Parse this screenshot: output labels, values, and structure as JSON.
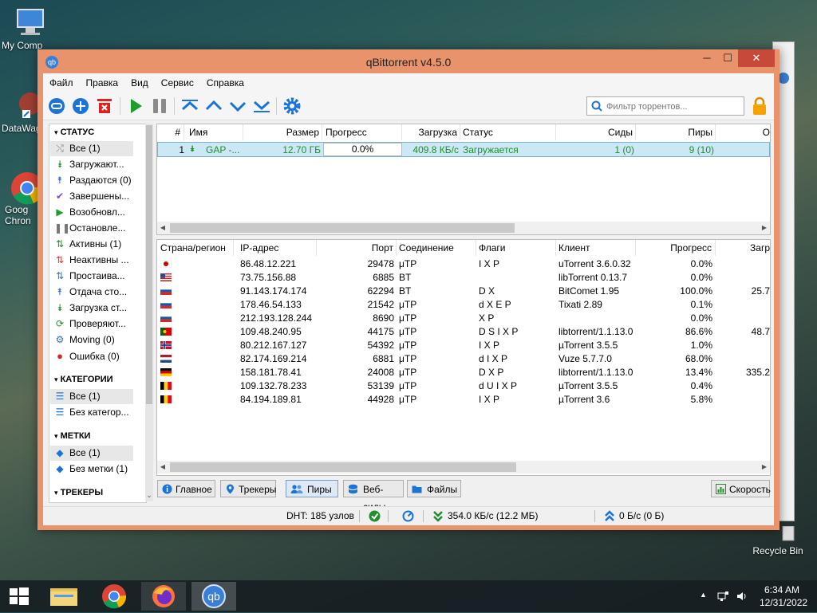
{
  "desktop": {
    "icons": [
      {
        "label": "My Comp"
      },
      {
        "label": "DataWag"
      },
      {
        "label": "Goog Chron"
      },
      {
        "label": "Recycle Bin"
      }
    ]
  },
  "window": {
    "title": "qBittorrent v4.5.0",
    "controls": {
      "minimize": "─",
      "maximize": "☐",
      "close": "✕"
    }
  },
  "menu": [
    "Файл",
    "Правка",
    "Вид",
    "Сервис",
    "Справка"
  ],
  "search": {
    "placeholder": "Фильтр торрентов..."
  },
  "sidebar": {
    "status_header": "СТАТУС",
    "status_items": [
      {
        "icon": "all",
        "label": "Все (1)",
        "color": "#888"
      },
      {
        "icon": "downloading",
        "label": "Загружают...",
        "color": "#1e8f2b"
      },
      {
        "icon": "seeding",
        "label": "Раздаются (0)",
        "color": "#3a6fc4"
      },
      {
        "icon": "completed",
        "label": "Завершены...",
        "color": "#7b4bc4"
      },
      {
        "icon": "resumed",
        "label": "Возобновл...",
        "color": "#1e9f2b"
      },
      {
        "icon": "paused",
        "label": "Остановле...",
        "color": "#777"
      },
      {
        "icon": "active",
        "label": "Активны (1)",
        "color": "#1e8f2b"
      },
      {
        "icon": "inactive",
        "label": "Неактивны ...",
        "color": "#d33"
      },
      {
        "icon": "stalled",
        "label": "Простаива...",
        "color": "#3a6fc4"
      },
      {
        "icon": "stalled-upload",
        "label": "Отдача сто...",
        "color": "#3a6fc4"
      },
      {
        "icon": "stalled-download",
        "label": "Загрузка ст...",
        "color": "#1e8f2b"
      },
      {
        "icon": "checking",
        "label": "Проверяют...",
        "color": "#1e8f2b"
      },
      {
        "icon": "moving",
        "label": "Moving (0)",
        "color": "#3a6fc4"
      },
      {
        "icon": "error",
        "label": "Ошибка (0)",
        "color": "#d22"
      }
    ],
    "categories_header": "КАТЕГОРИИ",
    "category_items": [
      {
        "label": "Все (1)"
      },
      {
        "label": "Без категор..."
      }
    ],
    "tags_header": "МЕТКИ",
    "tag_items": [
      {
        "label": "Все (1)"
      },
      {
        "label": "Без метки (1)"
      }
    ],
    "trackers_header": "ТРЕКЕРЫ"
  },
  "torrent_table": {
    "headers": [
      "#",
      "Имя",
      "Размер",
      "Прогресс",
      "Загрузка",
      "Статус",
      "Сиды",
      "Пиры",
      "О"
    ],
    "rows": [
      {
        "num": "1",
        "name": "GAP -...",
        "size": "12.70 ГБ",
        "progress": "0.0%",
        "dl_speed": "409.8 КБ/с",
        "status": "Загружается",
        "seeds": "1 (0)",
        "peers": "9 (10)"
      }
    ]
  },
  "peers_table": {
    "headers": [
      "Страна/регион",
      "IP-адрес",
      "Порт",
      "Соединение",
      "Флаги",
      "Клиент",
      "Прогресс",
      "Загр"
    ],
    "rows": [
      {
        "country": "jp",
        "ip": "86.48.12.221",
        "port": "29478",
        "conn": "μTP",
        "flags": "I X P",
        "client": "uTorrent 3.6.0.32",
        "progress": "0.0%",
        "dl": ""
      },
      {
        "country": "us",
        "ip": "73.75.156.88",
        "port": "6885",
        "conn": "BT",
        "flags": "",
        "client": "libTorrent 0.13.7",
        "progress": "0.0%",
        "dl": ""
      },
      {
        "country": "ru",
        "ip": "91.143.174.174",
        "port": "62294",
        "conn": "BT",
        "flags": "D X",
        "client": "BitComet 1.95",
        "progress": "100.0%",
        "dl": "25.7"
      },
      {
        "country": "ru",
        "ip": "178.46.54.133",
        "port": "21542",
        "conn": "μTP",
        "flags": "d X E P",
        "client": "Tixati 2.89",
        "progress": "0.1%",
        "dl": ""
      },
      {
        "country": "ru",
        "ip": "212.193.128.244",
        "port": "8690",
        "conn": "μTP",
        "flags": "X P",
        "client": "",
        "progress": "0.0%",
        "dl": ""
      },
      {
        "country": "pt",
        "ip": "109.48.240.95",
        "port": "44175",
        "conn": "μTP",
        "flags": "D S I X P",
        "client": "libtorrent/1.1.13.0",
        "progress": "86.6%",
        "dl": "48.7"
      },
      {
        "country": "no",
        "ip": "80.212.167.127",
        "port": "54392",
        "conn": "μTP",
        "flags": "I X P",
        "client": "µTorrent 3.5.5",
        "progress": "1.0%",
        "dl": ""
      },
      {
        "country": "nl",
        "ip": "82.174.169.214",
        "port": "6881",
        "conn": "μTP",
        "flags": "d I X P",
        "client": "Vuze 5.7.7.0",
        "progress": "68.0%",
        "dl": ""
      },
      {
        "country": "de",
        "ip": "158.181.78.41",
        "port": "24008",
        "conn": "μTP",
        "flags": "D X P",
        "client": "libtorrent/1.1.13.0",
        "progress": "13.4%",
        "dl": "335.2"
      },
      {
        "country": "be",
        "ip": "109.132.78.233",
        "port": "53139",
        "conn": "μTP",
        "flags": "d U I X P",
        "client": "µTorrent 3.5.5",
        "progress": "0.4%",
        "dl": ""
      },
      {
        "country": "be",
        "ip": "84.194.189.81",
        "port": "44928",
        "conn": "μTP",
        "flags": "I X P",
        "client": "µTorrent 3.6",
        "progress": "5.8%",
        "dl": ""
      }
    ]
  },
  "bottom_tabs": {
    "general": "Главное",
    "trackers": "Трекеры",
    "peers": "Пиры",
    "webseeds": "Веб-сиды",
    "files": "Файлы",
    "speed": "Скорость"
  },
  "statusbar": {
    "dht": "DHT: 185 узлов",
    "download": "354.0 КБ/с (12.2 МБ)",
    "upload": "0 Б/с (0 Б)"
  },
  "taskbar": {
    "time": "6:34 AM",
    "date": "12/31/2022"
  }
}
